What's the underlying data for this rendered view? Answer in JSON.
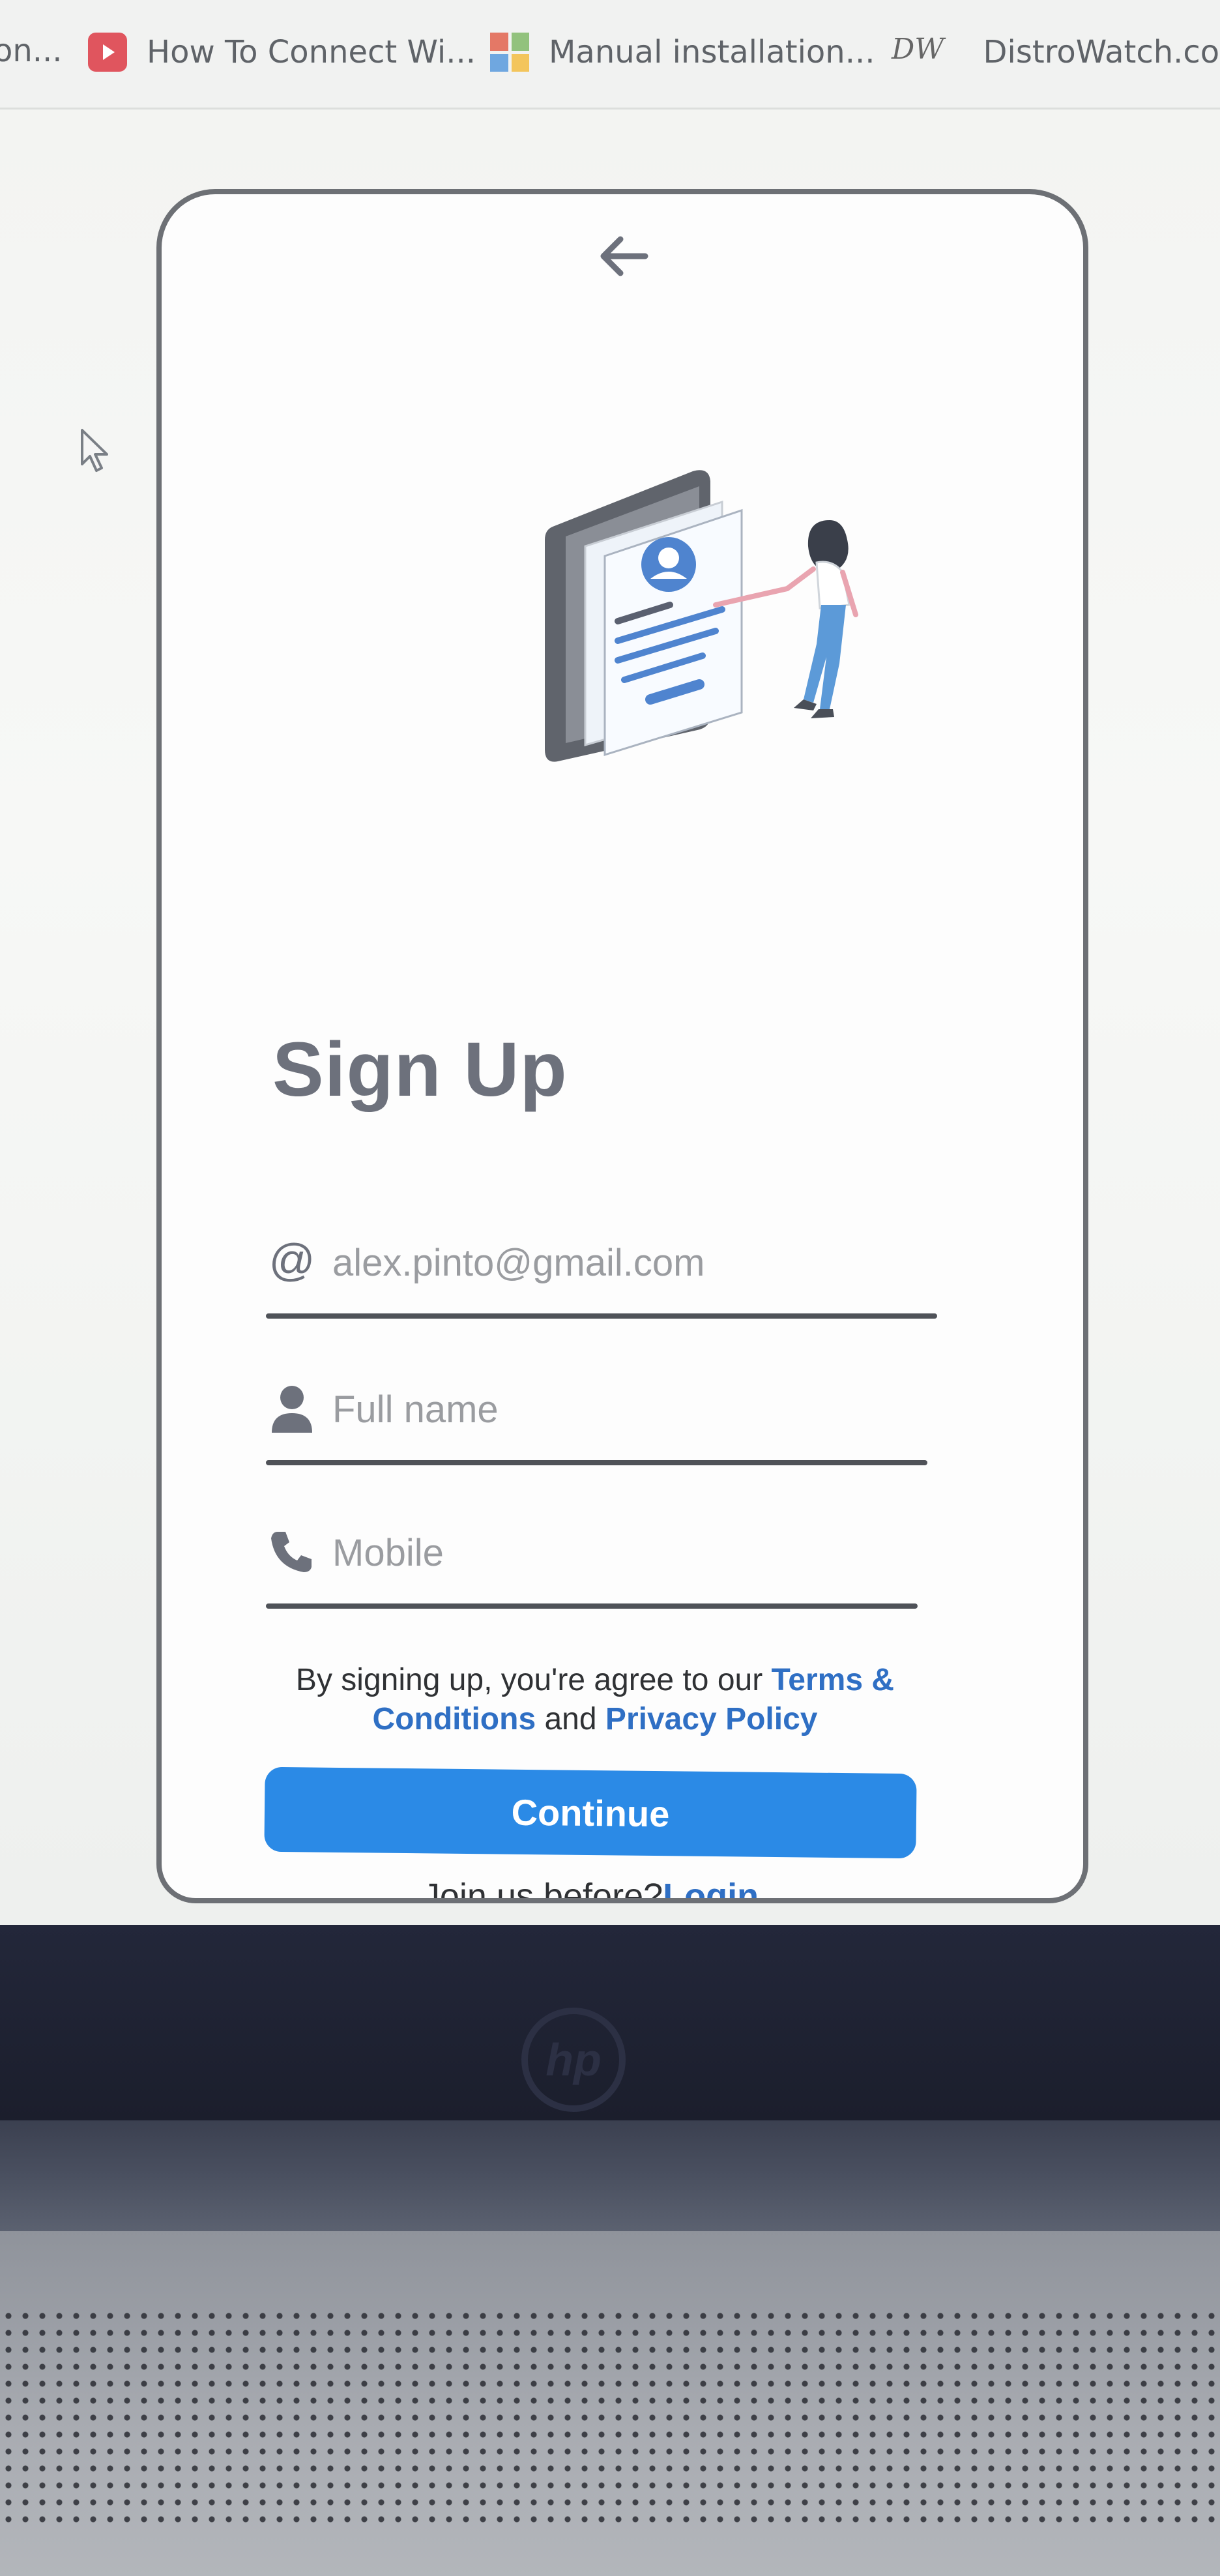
{
  "browser": {
    "bookmarks": [
      {
        "label": "on...",
        "icon": "generic-site-icon"
      },
      {
        "label": "How To Connect Wi...",
        "icon": "youtube-icon"
      },
      {
        "label": "Manual installation...",
        "icon": "microsoft-icon"
      },
      {
        "label": "DistroWatch.com: I",
        "icon": "distrowatch-icon",
        "icon_text": "DW"
      }
    ]
  },
  "signup": {
    "title": "Sign Up",
    "email": {
      "icon": "at-icon",
      "glyph": "@",
      "placeholder": "alex.pinto@gmail.com",
      "value": ""
    },
    "full_name": {
      "icon": "user-icon",
      "placeholder": "Full name",
      "value": ""
    },
    "mobile": {
      "icon": "phone-icon",
      "placeholder": "Mobile",
      "value": ""
    },
    "terms": {
      "prefix": "By signing up, you're agree to our",
      "terms_link": "Terms & Conditions",
      "and": "and",
      "privacy_link": "Privacy Policy"
    },
    "continue_label": "Continue",
    "join_prefix": "Join us before?",
    "login_link": "Login"
  },
  "laptop": {
    "brand": "hp"
  },
  "colors": {
    "accent": "#2b8ae6",
    "link": "#2f6fc4",
    "title": "#6d717c",
    "card_border": "#6d7075"
  }
}
